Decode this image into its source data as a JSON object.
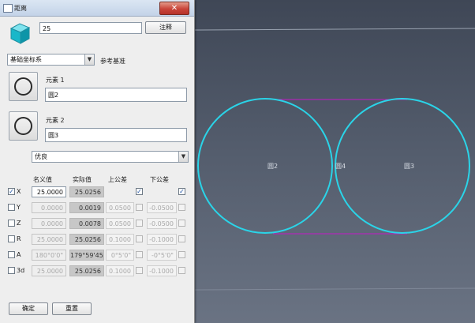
{
  "dialog": {
    "title": "距离",
    "close_glyph": "✕",
    "value_input": "25",
    "annotate_button": "注释",
    "datum_select": "基础坐标系",
    "datum_label": "参考基准",
    "element1_label": "元素 1",
    "element1_value": "圆2",
    "element2_label": "元素 2",
    "element2_value": "圆3",
    "mode_select": "优良",
    "table": {
      "headers": {
        "nominal": "名义值",
        "actual": "实际值",
        "upper": "上公差",
        "lower": "下公差"
      },
      "rows": [
        {
          "label": "X",
          "checked": true,
          "enabled": true,
          "nominal": "25.0000",
          "actual": "25.0256",
          "upper": "",
          "lower": "",
          "upper_checked": true,
          "lower_checked": true
        },
        {
          "label": "Y",
          "checked": false,
          "enabled": false,
          "nominal": "0.0000",
          "actual": "0.0019",
          "upper": "0.0500",
          "lower": "-0.0500",
          "upper_checked": false,
          "lower_checked": false
        },
        {
          "label": "Z",
          "checked": false,
          "enabled": false,
          "nominal": "0.0000",
          "actual": "0.0078",
          "upper": "0.0500",
          "lower": "-0.0500",
          "upper_checked": false,
          "lower_checked": false
        },
        {
          "label": "R",
          "checked": false,
          "enabled": false,
          "nominal": "25.0000",
          "actual": "25.0256",
          "upper": "0.1000",
          "lower": "-0.1000",
          "upper_checked": false,
          "lower_checked": false
        },
        {
          "label": "A",
          "checked": false,
          "enabled": false,
          "nominal": "180°0'0\"",
          "actual": "179°59'45",
          "upper": "0°5'0\"",
          "lower": "-0°5'0\"",
          "upper_checked": false,
          "lower_checked": false
        },
        {
          "label": "3d",
          "checked": false,
          "enabled": false,
          "nominal": "25.0000",
          "actual": "25.0256",
          "upper": "0.1000",
          "lower": "-0.1000",
          "upper_checked": false,
          "lower_checked": false
        }
      ]
    },
    "ok_button": "确定",
    "reset_button": "重置"
  },
  "viewport": {
    "circle1_label": "圆2",
    "mid_label": "圆4",
    "circle2_label": "圆3",
    "circle_color": "#2ad4e8",
    "line_color": "#c41ac6"
  }
}
